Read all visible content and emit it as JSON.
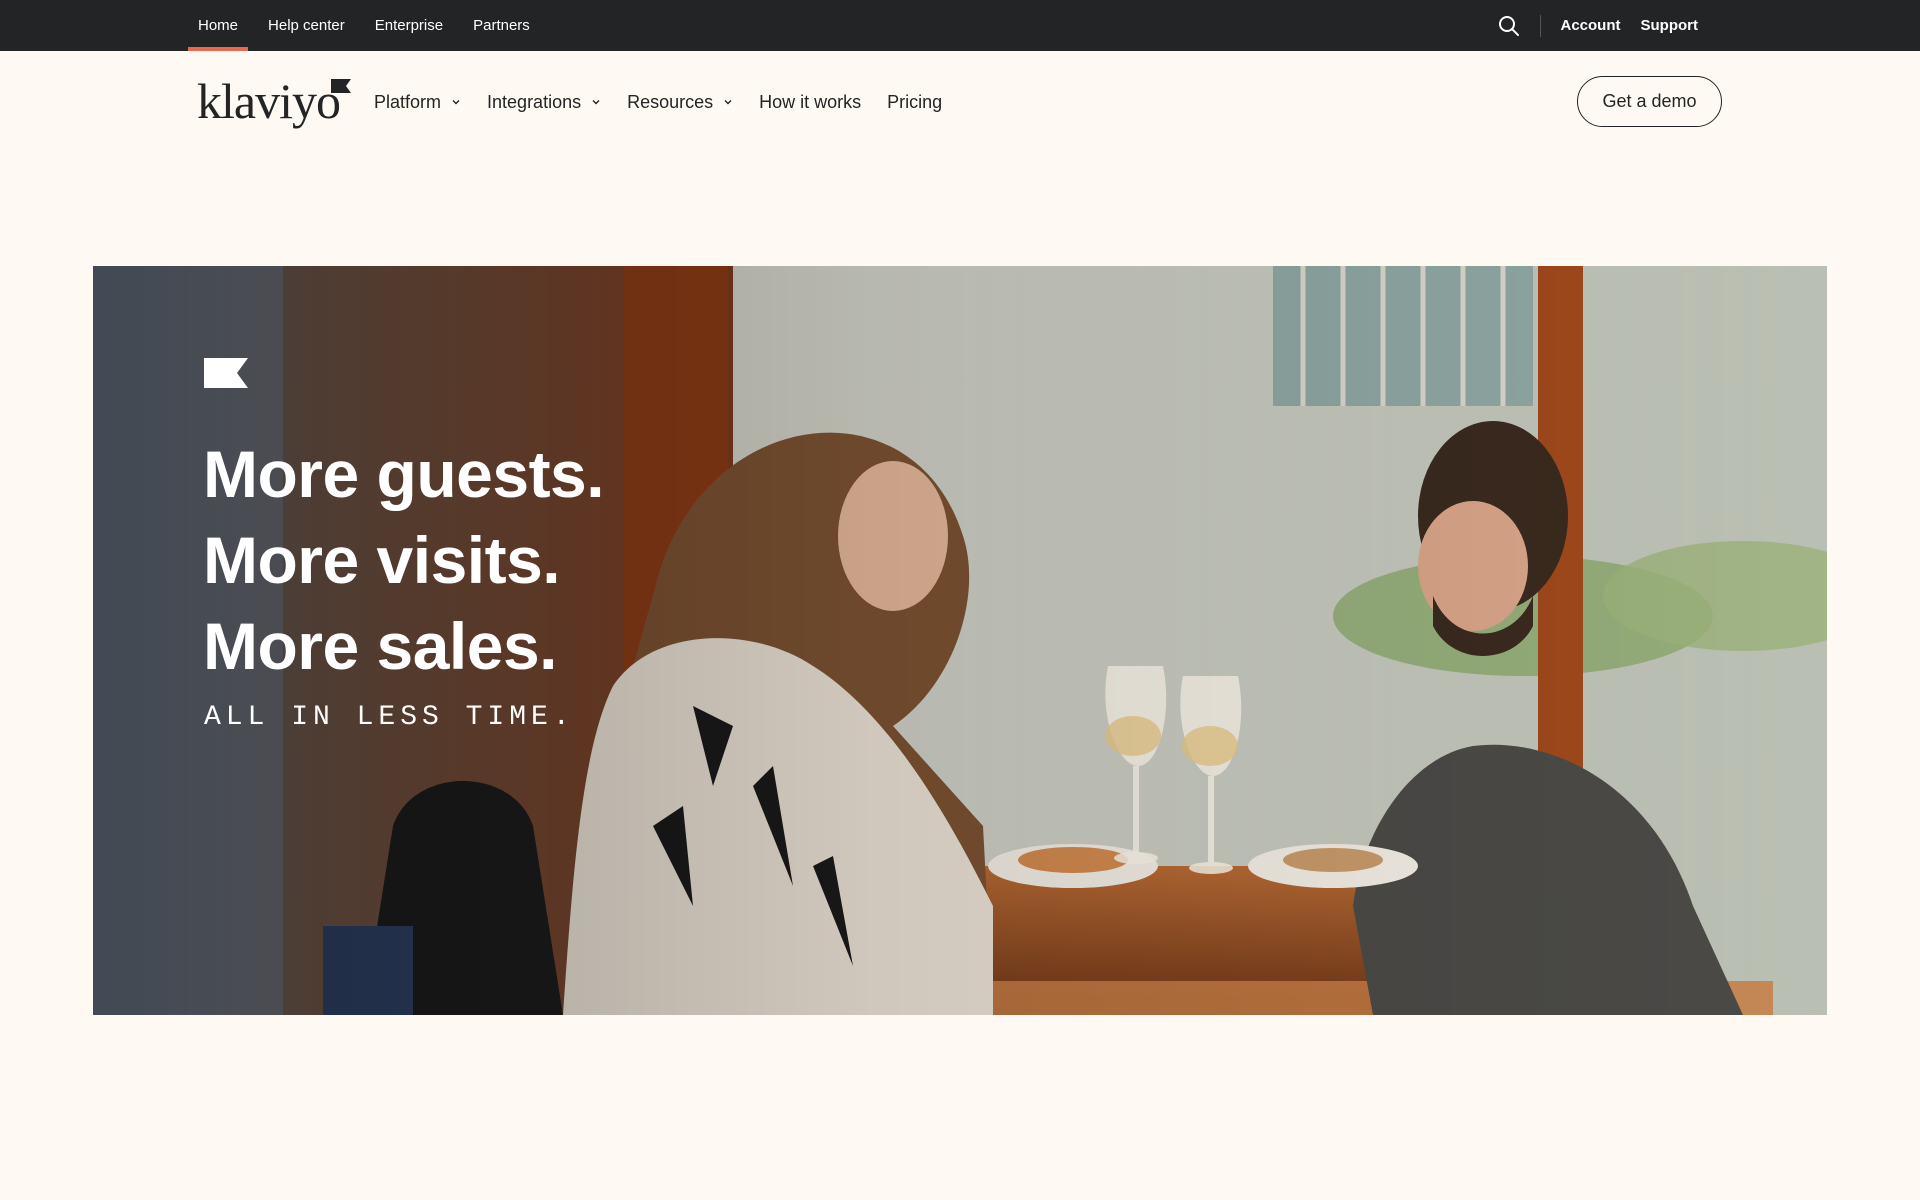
{
  "utility_bar": {
    "links": [
      {
        "label": "Home",
        "active": true
      },
      {
        "label": "Help center",
        "active": false
      },
      {
        "label": "Enterprise",
        "active": false
      },
      {
        "label": "Partners",
        "active": false
      }
    ],
    "search_icon": "search-icon",
    "account_label": "Account",
    "support_label": "Support"
  },
  "nav": {
    "logo_text": "klaviyo",
    "items": [
      {
        "label": "Platform",
        "has_dropdown": true
      },
      {
        "label": "Integrations",
        "has_dropdown": true
      },
      {
        "label": "Resources",
        "has_dropdown": true
      },
      {
        "label": "How it works",
        "has_dropdown": false
      },
      {
        "label": "Pricing",
        "has_dropdown": false
      }
    ],
    "cta_label": "Get a demo"
  },
  "hero": {
    "headline": [
      "More guests.",
      "More visits.",
      "More sales."
    ],
    "tagline": "ALL IN LESS TIME."
  },
  "colors": {
    "utility_bg": "#232426",
    "active_underline": "#e8694b",
    "page_bg": "#fef9f3",
    "text": "#232426"
  }
}
